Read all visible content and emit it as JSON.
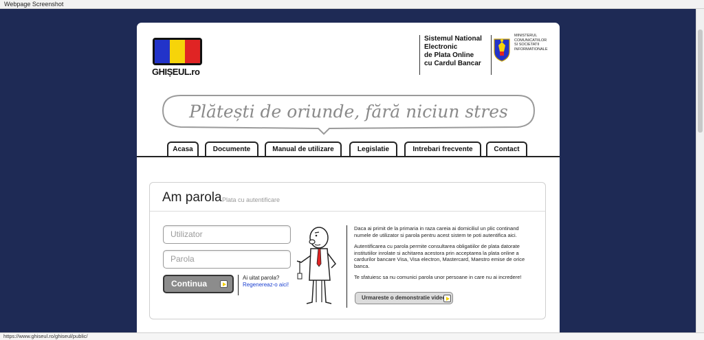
{
  "window": {
    "title": "Webpage Screenshot",
    "status_url": "https://www.ghiseul.ro/ghiseul/public/"
  },
  "colors": {
    "background": "#1e2a55",
    "flag_blue": "#2233c9",
    "flag_yellow": "#f6d40a",
    "flag_red": "#e02424",
    "link": "#1a3fd0",
    "button_gray": "#8c8c8c"
  },
  "header": {
    "logo_text": "GHIȘEUL.ro",
    "system_title": [
      "Sistemul National",
      "Electronic",
      "de Plata Online",
      "cu Cardul Bancar"
    ],
    "ministry": [
      "MINISTERUL",
      "COMUNICATIILOR",
      "SI SOCIETATII",
      "INFORMATIONALE"
    ],
    "crest_icon": "romanian-coat-of-arms-icon",
    "slogan": "Plătești de oriunde, fără niciun stres"
  },
  "nav": {
    "tabs": [
      {
        "label": "Acasa"
      },
      {
        "label": "Documente"
      },
      {
        "label": "Manual de utilizare"
      },
      {
        "label": "Legislatie"
      },
      {
        "label": "Intrebari frecvente"
      },
      {
        "label": "Contact"
      }
    ]
  },
  "login": {
    "title": "Am parola",
    "subtitle": "Plata cu autentificare",
    "username_placeholder": "Utilizator",
    "password_placeholder": "Parola",
    "submit_label": "Continua",
    "forgot_text": "Ai uitat parola?",
    "regenerate_link": "Regenereaz-o aici!"
  },
  "info": {
    "paragraphs": [
      "Daca ai primit de la primaria in raza careia ai domiciliul un plic continand numele de utilizator si parola pentru acest sistem te poti autentifica aici.",
      "Autentificarea cu parola permite consultarea obligatiilor de plata datorate institutiilor inrolate si achitarea acestora prin acceptarea la plata online a cardurilor bancare Visa, Visa electron, Mastercard, Maestro emise de orice banca.",
      "Te sfatuiesc sa nu comunici parola unor persoane in care nu ai incredere!"
    ],
    "demo_button": "Urmareste o demonstratie video"
  }
}
